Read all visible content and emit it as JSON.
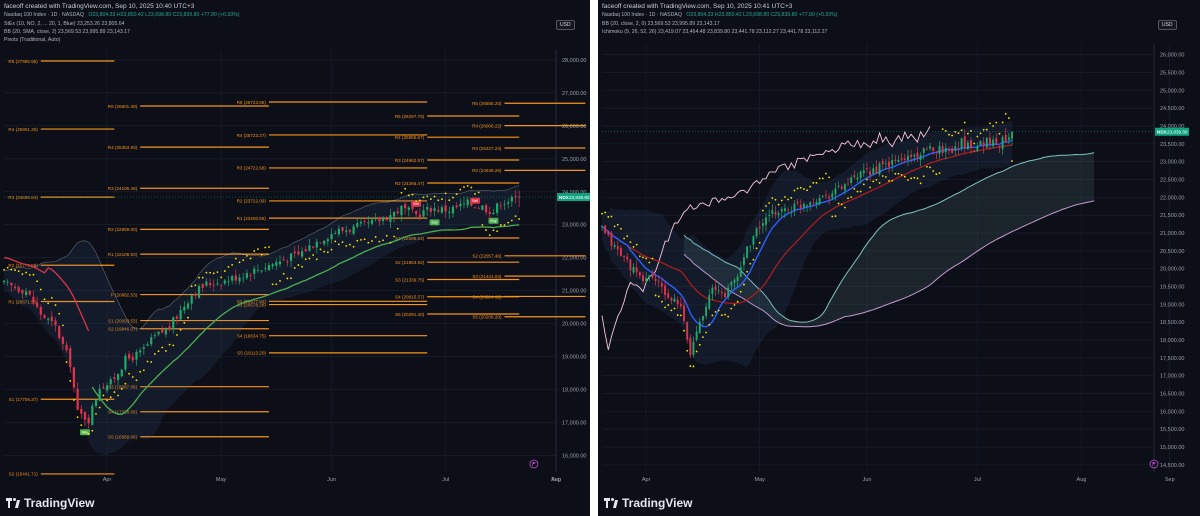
{
  "colors": {
    "background": "#0c0f17",
    "grid": "#1b2030",
    "up": "#22a86a",
    "down": "#e0334a",
    "pivot": "#f7931a",
    "parabolic_sar": "#ffe600",
    "bb": "#ffffff",
    "supertrend_up": "#4caf50",
    "supertrend_down": "#e0334a",
    "ichimoku_conversion": "#2962ff",
    "ichimoku_base": "#b71c1c",
    "ichimoku_lagging": "#f7c6dd",
    "ichimoku_span_a": "#82c4c3",
    "ichimoku_span_b": "#c59ad1",
    "price_tag": "#0fa37f"
  },
  "left": {
    "attribution": "faceoff created with TradingView.com, Sep 10, 2025 10:40 UTC+3",
    "legend": {
      "symbol": "Nasdaq 100 Index · 1D · NASDAQ",
      "ohlc": "O23,804.33  H23,850.42  L23,698.80  C23,839.80  +77.90 (+0.33%)",
      "supertrend": "StEx (10, NO, 2, ...              20, 1, Blue)  23,253.26  23,805.64",
      "bb": "BB (20, SMA, close, 2)  23,569.53  23,995.89  23,143.17",
      "pivots": "Pivots (Traditional, Auto)"
    },
    "usd": "USD",
    "price_tag": {
      "symbol": "NDX",
      "value": "23,839.80"
    },
    "signals": [
      {
        "text": "Sell"
      },
      {
        "text": "Sell"
      },
      {
        "text": "Buy"
      },
      {
        "text": "Buy"
      },
      {
        "text": "Buy"
      }
    ],
    "pivot_labels": [
      {
        "text": "R5 (27965.95)",
        "value": 27965.95,
        "period": 0
      },
      {
        "text": "R4 (25901.30)",
        "value": 25901.3,
        "period": 0
      },
      {
        "text": "R3 (23836.64)",
        "value": 23836.64,
        "period": 0
      },
      {
        "text": "R2 (21771.99)",
        "value": 21771.99,
        "period": 0
      },
      {
        "text": "R1 (20671.50)",
        "value": 20671.5,
        "period": 0
      },
      {
        "text": "S1 (17706.37)",
        "value": 17706.37,
        "period": 0
      },
      {
        "text": "S2 (15441.71)",
        "value": 15441.71,
        "period": 0
      },
      {
        "text": "R5 (26601.39)",
        "value": 26601.39,
        "period": 1
      },
      {
        "text": "R4 (25353.93)",
        "value": 25353.93,
        "period": 1
      },
      {
        "text": "R3 (24106.46)",
        "value": 24106.46,
        "period": 1
      },
      {
        "text": "R2 (22859.00)",
        "value": 22859.0,
        "period": 1
      },
      {
        "text": "R1 (22108.93)",
        "value": 22108.93,
        "period": 1
      },
      {
        "text": "P (20882.53)",
        "value": 20882.53,
        "period": 1
      },
      {
        "text": "S1 (20093.53)",
        "value": 20093.53,
        "period": 1
      },
      {
        "text": "S2 (19846.07)",
        "value": 19846.07,
        "period": 1
      },
      {
        "text": "S3 (18087.06)",
        "value": 18087.06,
        "period": 1
      },
      {
        "text": "S4 (17328.06)",
        "value": 17328.06,
        "period": 1
      },
      {
        "text": "S5 (16569.06)",
        "value": 16569.06,
        "period": 1
      },
      {
        "text": "R5 (26723.86)",
        "value": 26723.86,
        "period": 2
      },
      {
        "text": "R4 (25723.27)",
        "value": 25723.27,
        "period": 2
      },
      {
        "text": "R3 (24722.68)",
        "value": 24722.68,
        "period": 2
      },
      {
        "text": "R2 (23722.09)",
        "value": 23722.09,
        "period": 2
      },
      {
        "text": "R1 (23200.55)",
        "value": 23200.55,
        "period": 2
      },
      {
        "text": "S2 (20677.82)",
        "value": 20677.82,
        "period": 2
      },
      {
        "text": "S3 (20578.28)",
        "value": 20578.28,
        "period": 2
      },
      {
        "text": "S4 (19634.75)",
        "value": 19634.75,
        "period": 2
      },
      {
        "text": "S5 (19113.20)",
        "value": 19113.2,
        "period": 2
      },
      {
        "text": "R5 (26297.78)",
        "value": 26297.78,
        "period": 3
      },
      {
        "text": "R4 (25655.67)",
        "value": 25655.67,
        "period": 3
      },
      {
        "text": "R3 (24962.57)",
        "value": 24962.57,
        "period": 3
      },
      {
        "text": "R2 (24266.47)",
        "value": 24266.47,
        "period": 3
      },
      {
        "text": "S1 (22596.54)",
        "value": 22596.54,
        "period": 3
      },
      {
        "text": "S2 (21863.92)",
        "value": 21863.92,
        "period": 3
      },
      {
        "text": "S3 (21339.75)",
        "value": 21339.75,
        "period": 3
      },
      {
        "text": "S4 (20815.57)",
        "value": 20815.57,
        "period": 3
      },
      {
        "text": "S5 (20291.40)",
        "value": 20291.4,
        "period": 3
      },
      {
        "text": "R5 (26685.20)",
        "value": 26685.2,
        "period": 4
      },
      {
        "text": "R4 (26006.22)",
        "value": 26006.22,
        "period": 4
      },
      {
        "text": "R3 (25327.24)",
        "value": 25327.24,
        "period": 4
      },
      {
        "text": "R2 (24648.26)",
        "value": 24648.26,
        "period": 4
      },
      {
        "text": "S2 (22057.46)",
        "value": 22057.46,
        "period": 4
      },
      {
        "text": "S3 (21441.04)",
        "value": 21441.04,
        "period": 4
      },
      {
        "text": "S4 (20824.62)",
        "value": 20824.62,
        "period": 4
      },
      {
        "text": "S5 (20208.20)",
        "value": 20208.2,
        "period": 4
      }
    ]
  },
  "right": {
    "attribution": "faceoff created with TradingView.com, Sep 10, 2025 10:41 UTC+3",
    "legend": {
      "symbol": "Nasdaq 100 Index · 1D · NASDAQ",
      "ohlc": "O23,804.33  H23,850.42  L23,698.80  C23,839.80  +77.90 (+0.33%)",
      "bb": "BB (20, close, 2, 0)  23,569.53  23,995.89  23,143.17",
      "ichimoku": "Ichimoku (9, 26, 52, 26)  23,419.07  23,464.48  23,839.80  23,441.78  23,112.27  23,441.78  23,112.27"
    },
    "usd": "USD",
    "price_tag": {
      "symbol": "NDX",
      "value": "23,839.80"
    }
  },
  "chart_data": [
    {
      "type": "candlestick",
      "title": "Nasdaq 100 Index · 1D · NASDAQ",
      "x_ticks": [
        "Apr",
        "May",
        "Jun",
        "Jul",
        "Aug",
        "Sep"
      ],
      "y_ticks": [
        "28,000.00",
        "27,000.00",
        "26,000.00",
        "25,000.00",
        "24,000.00",
        "23,000.00",
        "22,000.00",
        "21,000.00",
        "20,000.00",
        "19,000.00",
        "18,000.00",
        "17,000.00",
        "16,000.00"
      ],
      "ylim": [
        15500,
        28300
      ],
      "x_range": [
        0,
        150
      ],
      "last": 23839.8,
      "close_anchors": [
        [
          0,
          21200
        ],
        [
          6,
          21000
        ],
        [
          10,
          20300
        ],
        [
          14,
          19900
        ],
        [
          18,
          18800
        ],
        [
          20,
          17300
        ],
        [
          23,
          17100
        ],
        [
          26,
          18100
        ],
        [
          29,
          18200
        ],
        [
          33,
          18900
        ],
        [
          37,
          19100
        ],
        [
          41,
          19600
        ],
        [
          45,
          19900
        ],
        [
          48,
          20400
        ],
        [
          51,
          20900
        ],
        [
          55,
          21200
        ],
        [
          60,
          21300
        ],
        [
          65,
          21500
        ],
        [
          70,
          21700
        ],
        [
          75,
          21900
        ],
        [
          80,
          22100
        ],
        [
          85,
          22500
        ],
        [
          90,
          22800
        ],
        [
          95,
          22900
        ],
        [
          100,
          23050
        ],
        [
          105,
          23300
        ],
        [
          108,
          23500
        ],
        [
          112,
          23300
        ],
        [
          116,
          23500
        ],
        [
          121,
          23450
        ],
        [
          126,
          23650
        ],
        [
          130,
          23550
        ],
        [
          133,
          23400
        ],
        [
          135,
          23700
        ],
        [
          138,
          23750
        ],
        [
          140,
          23839.8
        ]
      ]
    },
    {
      "type": "candlestick",
      "title": "Nasdaq 100 Index · 1D · NASDAQ",
      "x_ticks": [
        "Apr",
        "May",
        "Jun",
        "Jul",
        "Aug",
        "Sep",
        "Oct"
      ],
      "y_ticks": [
        "26,000.00",
        "25,500.00",
        "25,000.00",
        "24,500.00",
        "24,000.00",
        "23,500.00",
        "23,000.00",
        "22,500.00",
        "22,000.00",
        "21,500.00",
        "21,000.00",
        "20,500.00",
        "20,000.00",
        "19,500.00",
        "19,000.00",
        "18,500.00",
        "18,000.00",
        "17,500.00",
        "17,000.00",
        "16,500.00",
        "16,000.00",
        "15,500.00",
        "15,000.00",
        "14,500.00"
      ],
      "ylim": [
        14300,
        26300
      ],
      "x_range": [
        0,
        175
      ],
      "last": 23839.8,
      "close_anchors": [
        [
          0,
          21100
        ],
        [
          4,
          20600
        ],
        [
          8,
          20200
        ],
        [
          12,
          19700
        ],
        [
          16,
          19800
        ],
        [
          20,
          19300
        ],
        [
          25,
          18900
        ],
        [
          28,
          17600
        ],
        [
          31,
          18600
        ],
        [
          35,
          19400
        ],
        [
          39,
          19300
        ],
        [
          43,
          19800
        ],
        [
          46,
          20600
        ],
        [
          50,
          21200
        ],
        [
          55,
          21600
        ],
        [
          60,
          21700
        ],
        [
          66,
          21900
        ],
        [
          72,
          22100
        ],
        [
          78,
          22400
        ],
        [
          84,
          22700
        ],
        [
          90,
          22900
        ],
        [
          96,
          23100
        ],
        [
          102,
          23250
        ],
        [
          106,
          23400
        ],
        [
          110,
          23300
        ],
        [
          114,
          23550
        ],
        [
          118,
          23400
        ],
        [
          122,
          23600
        ],
        [
          126,
          23500
        ],
        [
          130,
          23839.8
        ]
      ]
    }
  ]
}
